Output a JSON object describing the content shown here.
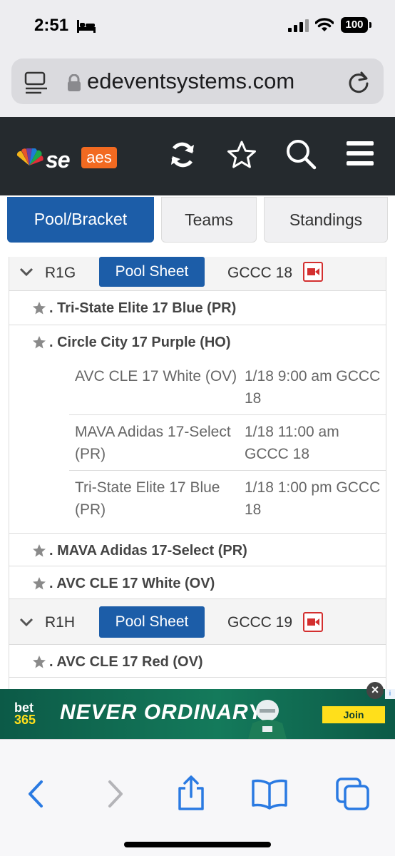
{
  "status_bar": {
    "time": "2:51",
    "battery": "100"
  },
  "browser": {
    "url": "edeventsystems.com"
  },
  "site": {
    "logo_text": "se",
    "badge_text": "aes"
  },
  "tabs": [
    {
      "label": "Pool/Bracket",
      "active": true
    },
    {
      "label": "Teams",
      "active": false
    },
    {
      "label": "Standings",
      "active": false
    }
  ],
  "pools": [
    {
      "id": "R1G",
      "sheet_label": "Pool Sheet",
      "court": "GCCC 18",
      "teams": [
        {
          "name": ". Tri-State Elite 17 Blue (PR)"
        },
        {
          "name": ". Circle City 17 Purple (HO)",
          "matches": [
            {
              "opponent": "AVC CLE 17 White (OV)",
              "time": "1/18 9:00 am GCCC 18"
            },
            {
              "opponent": "MAVA Adidas 17-Select (PR)",
              "time": "1/18 11:00 am GCCC 18"
            },
            {
              "opponent": "Tri-State Elite 17 Blue (PR)",
              "time": "1/18 1:00 pm GCCC 18"
            }
          ]
        },
        {
          "name": ". MAVA Adidas 17-Select (PR)"
        },
        {
          "name": ". AVC CLE 17 White (OV)"
        }
      ]
    },
    {
      "id": "R1H",
      "sheet_label": "Pool Sheet",
      "court": "GCCC 19",
      "teams": [
        {
          "name": ". AVC CLE 17 Red (OV)"
        }
      ]
    }
  ],
  "ad": {
    "brand_top": "bet",
    "brand_bottom": "365",
    "slogan": "NEVER ORDINARY",
    "cta": "Join",
    "close": "×",
    "info": "i"
  },
  "icons": [
    "bed-icon",
    "signal-icon",
    "wifi-icon",
    "reader-icon",
    "lock-icon",
    "reload-icon",
    "nbc-peacock-icon",
    "refresh-icon",
    "star-icon",
    "search-icon",
    "menu-icon",
    "chevron-down-icon",
    "video-icon",
    "back-icon",
    "forward-icon",
    "share-icon",
    "bookmarks-icon",
    "tabs-icon"
  ],
  "colors": {
    "header": "#252a2e",
    "accent": "#1c5da8",
    "badge": "#f26a21",
    "video": "#d32f2f",
    "ad": "#0f5e4a",
    "cta": "#ffdf1b"
  }
}
